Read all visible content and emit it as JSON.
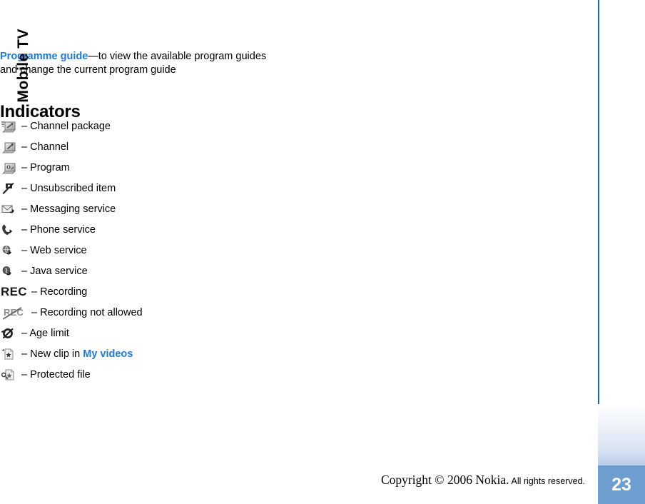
{
  "document": {
    "sidebar_title": "Mobile TV",
    "page_number": "23"
  },
  "intro": {
    "link_text": "Programme guide",
    "rest_line1": "—to view the available program guides",
    "line2": "and change the current program guide"
  },
  "section": {
    "title": "Indicators"
  },
  "indicators": [
    {
      "icon": "channel-package-icon",
      "separator": "–",
      "label": "Channel package"
    },
    {
      "icon": "channel-icon",
      "separator": "–",
      "label": "Channel"
    },
    {
      "icon": "program-icon",
      "separator": "–",
      "label": "Program"
    },
    {
      "icon": "unsubscribed-item-icon",
      "separator": "–",
      "label": "Unsubscribed item"
    },
    {
      "icon": "messaging-service-icon",
      "separator": "–",
      "label": "Messaging service"
    },
    {
      "icon": "phone-service-icon",
      "separator": "–",
      "label": "Phone service"
    },
    {
      "icon": "web-service-icon",
      "separator": "–",
      "label": "Web service"
    },
    {
      "icon": "java-service-icon",
      "separator": "–",
      "label": "Java service"
    },
    {
      "icon": "recording-icon",
      "separator": "–",
      "label": "Recording",
      "icon_text": "REC"
    },
    {
      "icon": "recording-not-allowed-icon",
      "separator": "–",
      "label": "Recording not allowed",
      "icon_text": "REC"
    },
    {
      "icon": "age-limit-icon",
      "separator": "–",
      "label": "Age limit"
    },
    {
      "icon": "new-clip-icon",
      "separator": "–",
      "label_prefix": "New clip in ",
      "link_text": "My videos"
    },
    {
      "icon": "protected-file-icon",
      "separator": "–",
      "label": "Protected file"
    }
  ],
  "footer": {
    "copyright": "Copyright © 2006 Nokia.",
    "rights": "All rights reserved."
  },
  "colors": {
    "link_blue": "#1c7ae0",
    "rule_blue": "#1364a8",
    "page_block_blue": "#6e9dd0"
  }
}
